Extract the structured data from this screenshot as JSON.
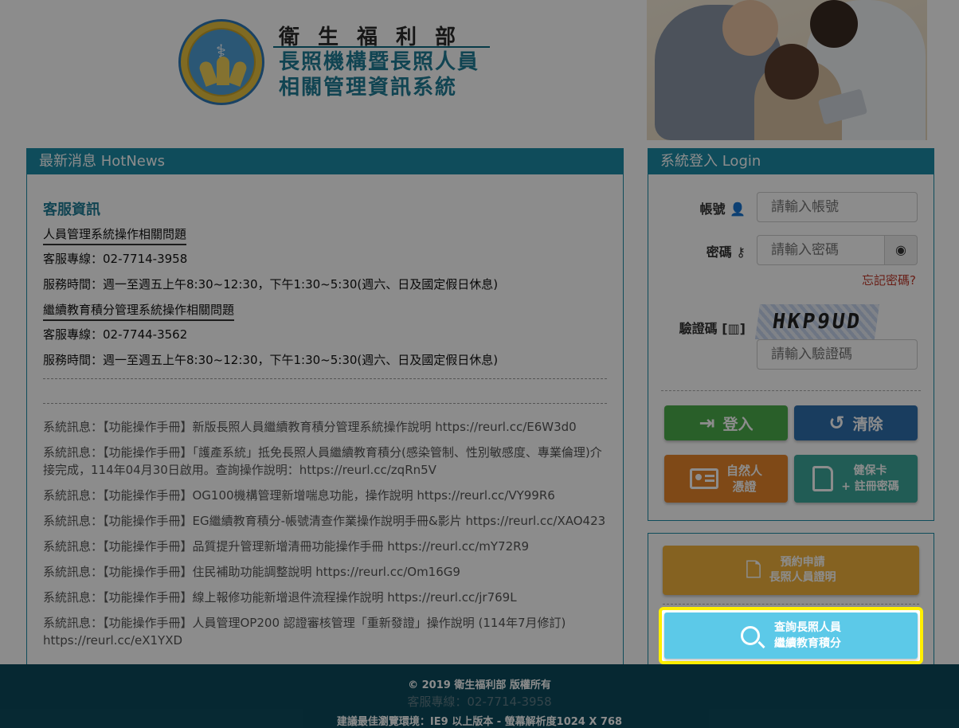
{
  "header": {
    "ministry": "衛生福利部",
    "system_title_line1": "長照機構暨長照人員",
    "system_title_line2": "相關管理資訊系統",
    "logo_text": "衛生福利部"
  },
  "news": {
    "heading": "最新消息 HotNews",
    "cs_title": "客服資訊",
    "sections": [
      {
        "title": "人員管理系統操作相關問題",
        "phone": "客服專線：02-7714-3958",
        "hours": "服務時間：週一至週五上午8:30~12:30，下午1:30~5:30(週六、日及國定假日休息)"
      },
      {
        "title": "繼續教育積分管理系統操作相關問題",
        "phone": "客服專線：02-7744-3562",
        "hours": "服務時間：週一至週五上午8:30~12:30，下午1:30~5:30(週六、日及國定假日休息)"
      }
    ],
    "messages": [
      "系統訊息：【功能操作手冊】新版長照人員繼續教育積分管理系統操作說明 https://reurl.cc/E6W3d0",
      "系統訊息：【功能操作手冊】「護產系統」抵免長照人員繼續教育積分(感染管制、性別敏感度、專業倫理)介接完成，114年04月30日啟用。查詢操作說明：https://reurl.cc/zqRn5V",
      "系統訊息：【功能操作手冊】OG100機構管理新增喘息功能，操作說明 https://reurl.cc/VY99R6",
      "系統訊息：【功能操作手冊】EG繼續教育積分-帳號清查作業操作說明手冊&影片 https://reurl.cc/XAO423",
      "系統訊息：【功能操作手冊】品質提升管理新增清冊功能操作手冊 https://reurl.cc/mY72R9",
      "系統訊息：【功能操作手冊】住民補助功能調整說明 https://reurl.cc/Om16G9",
      "系統訊息：【功能操作手冊】線上報修功能新增退件流程操作說明 https://reurl.cc/jr769L",
      "系統訊息：【功能操作手冊】人員管理OP200 認證審核管理「重新發證」操作說明 (114年7月修訂) https://reurl.cc/eX1YXD"
    ]
  },
  "login": {
    "heading": "系統登入 Login",
    "account_label": "帳號",
    "account_placeholder": "請輸入帳號",
    "password_label": "密碼",
    "password_placeholder": "請輸入密碼",
    "forgot": "忘記密碼?",
    "captcha_label": "驗證碼",
    "captcha_text": "HKP9UD",
    "captcha_placeholder": "請輸入驗證碼",
    "login_btn": "登入",
    "clear_btn": "清除",
    "cert_btn_line1": "自然人",
    "cert_btn_line2": "憑證",
    "card_btn_line1": "健保卡",
    "card_btn_line2": "+ 註冊密碼"
  },
  "actions": {
    "apply_line1": "預約申請",
    "apply_line2": "長照人員證明",
    "query_line1": "查詢長照人員",
    "query_line2": "繼續教育積分"
  },
  "footer": {
    "copyright": "© 2019 衛生福利部 版權所有",
    "hotline": "客服專線：02-7714-3958",
    "browser": "建議最佳瀏覽環境：IE9 以上版本 - 螢幕解析度1024 X 768"
  },
  "colors": {
    "teal": "#1c8aa6",
    "green": "#4cae4c",
    "blue": "#2f6fae",
    "orange": "#e8862a",
    "aqua_green": "#3da89b",
    "gold": "#f2b33d",
    "sky": "#5cc9e8",
    "highlight": "#ffef00"
  },
  "icons": [
    "user-icon",
    "key-icon",
    "eye-icon",
    "barcode-icon",
    "sign-in-icon",
    "undo-icon",
    "id-card-icon",
    "sim-card-icon",
    "doc-search-icon",
    "search-icon"
  ]
}
